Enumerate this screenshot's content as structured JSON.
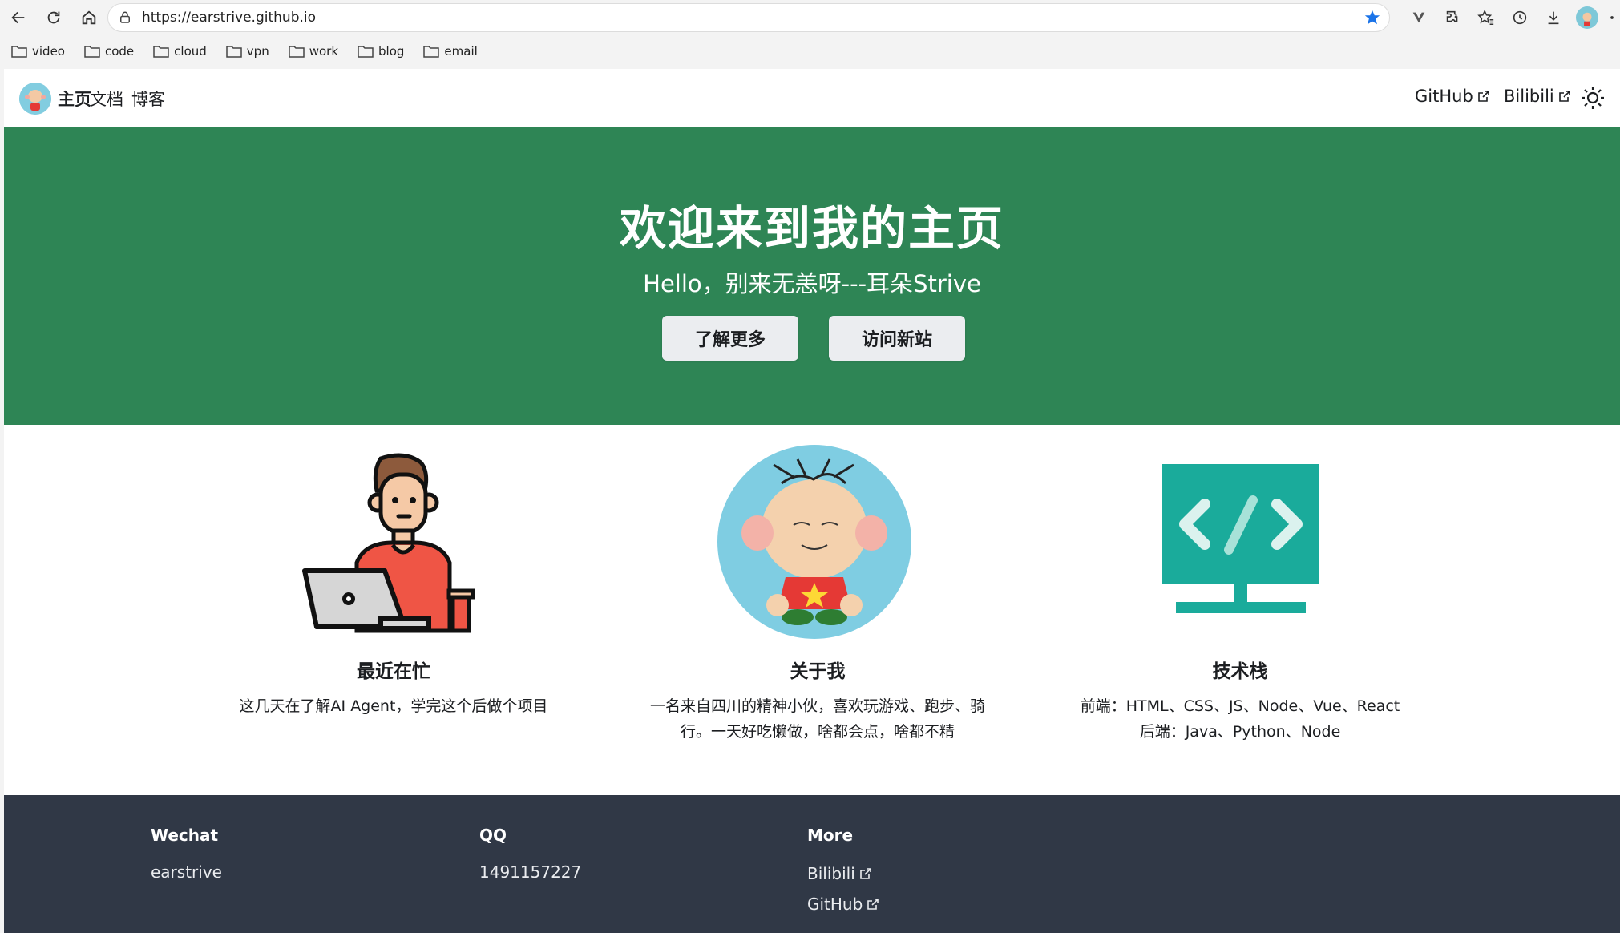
{
  "browser": {
    "url": "https://earstrive.github.io",
    "bookmarks": [
      "video",
      "code",
      "cloud",
      "vpn",
      "work",
      "blog",
      "email"
    ]
  },
  "navbar": {
    "brand": "主页",
    "links": [
      "文档",
      "博客"
    ],
    "right_links": [
      "GitHub",
      "Bilibili"
    ]
  },
  "hero": {
    "title": "欢迎来到我的主页",
    "subtitle": "Hello，别来无恙呀---耳朵Strive",
    "buttons": [
      "了解更多",
      "访问新站"
    ]
  },
  "features": [
    {
      "title": "最近在忙",
      "desc": [
        "这几天在了解AI Agent，学完这个后做个项目"
      ]
    },
    {
      "title": "关于我",
      "desc": [
        "一名来自四川的精神小伙，喜欢玩游戏、跑步、骑",
        "行。一天好吃懒做，啥都会点，啥都不精"
      ]
    },
    {
      "title": "技术栈",
      "desc": [
        "前端：HTML、CSS、JS、Node、Vue、React",
        "后端：Java、Python、Node"
      ]
    }
  ],
  "footer": {
    "columns": [
      {
        "title": "Wechat",
        "items": [
          "earstrive"
        ]
      },
      {
        "title": "QQ",
        "items": [
          "1491157227"
        ]
      },
      {
        "title": "More",
        "items": [
          "Bilibili",
          "GitHub"
        ]
      }
    ]
  },
  "colors": {
    "hero_bg": "#2e8555",
    "footer_bg": "#303846",
    "button_bg": "#ebedf0",
    "accent_teal": "#1aab9b"
  }
}
